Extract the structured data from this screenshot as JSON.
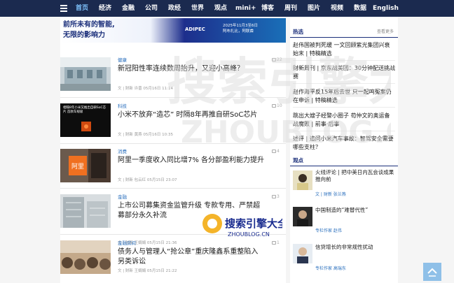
{
  "nav": {
    "items": [
      {
        "label": "首页",
        "active": true
      },
      {
        "label": "经济"
      },
      {
        "label": "金融"
      },
      {
        "label": "公司"
      },
      {
        "label": "政经"
      },
      {
        "label": "世界"
      },
      {
        "label": "观点"
      },
      {
        "label": "mini+"
      },
      {
        "label": "博客"
      },
      {
        "label": "周刊"
      },
      {
        "label": "图片"
      },
      {
        "label": "视频"
      },
      {
        "label": "数据"
      },
      {
        "label": "English"
      }
    ]
  },
  "banner": {
    "line1": "前所未有的智能,",
    "line2": "无限的影响力",
    "logo": "ADIPEC",
    "info1": "2025年11月3至6日",
    "info2": "阿布扎比，阿联酋"
  },
  "articles": [
    {
      "category": "健康",
      "title": "新冠阳性率连续数周抬升，又迎小高峰？",
      "meta": "文 | 财新 许晋 05月16日 11:14",
      "comments": "22"
    },
    {
      "category": "科技",
      "title": "小米不放弃“造芯” 时隔8年再推自研SoC芯片",
      "meta": "文 | 财新 黄燕 05月16日 10:35",
      "comments": "10",
      "thumb_text": "相隔8年小米又推出自研SoC芯片 首款车规级"
    },
    {
      "category": "消费",
      "title": "阿里一季度收入同比增7% 各分部盈利能力提升",
      "meta": "文 | 财新 包云红 05月15日 23:07",
      "comments": "4"
    },
    {
      "category": "金融",
      "title": "上市公司募集资金监管升级 专款专用、严禁超募部分永久补流",
      "meta": "文 | 财新 王娟娟 05月15日 21:36",
      "comments": "3"
    },
    {
      "category": "金融房间",
      "title": "债务人与管理人“抢公章”重庆隆鑫系重整陷入另类诉讼",
      "meta": "文 | 财新 王娟娟 05月15日 21:22",
      "comments": "1"
    }
  ],
  "sidebar": {
    "hot_title": "热选",
    "hot_more": "查看更多",
    "hot_items": [
      "赵伟国被判死缓 一文回顾紫光集团兴衰始末 | 特稿精选",
      "财新周刊 | 京东战美团：30分钟配送挑战赛",
      "赵作海平反15年后去世 只一起鸣冤案仍在申诉 | 特稿精选",
      "跳出大嫂子经警小圈子 苟仲文的奥运备战腐败 | 前事·后事",
      "述评 | 追问小米汽车事故：智驾安全需要哪些支柱？"
    ],
    "opinion_title": "观点",
    "opinions": [
      {
        "title": "火线评论 | 把中美日内瓦会谈成果推向前",
        "author": "文 | 财新 张兰燕"
      },
      {
        "title": "中国制造的“难替代性”",
        "author": "专栏作家 赵伟"
      },
      {
        "title": "信贷增长的非常规性扰动",
        "author": "专栏作家 高瑞东"
      }
    ]
  },
  "watermark": {
    "large_text": "搜索引擎大全",
    "large_domain": "ZHOUBLOG.CN",
    "small_text": "搜索引擎大全",
    "small_domain": "ZHOUBLOG.CN"
  },
  "colors": {
    "nav_bg": "#1b2a4f",
    "nav_active": "#7fc4ff",
    "accent_blue": "#2a6fbd",
    "section_title": "#1a2e7a"
  },
  "icons": {
    "menu": "hamburger-icon",
    "comment": "comment-icon",
    "back_top": "arrow-up-icon"
  }
}
